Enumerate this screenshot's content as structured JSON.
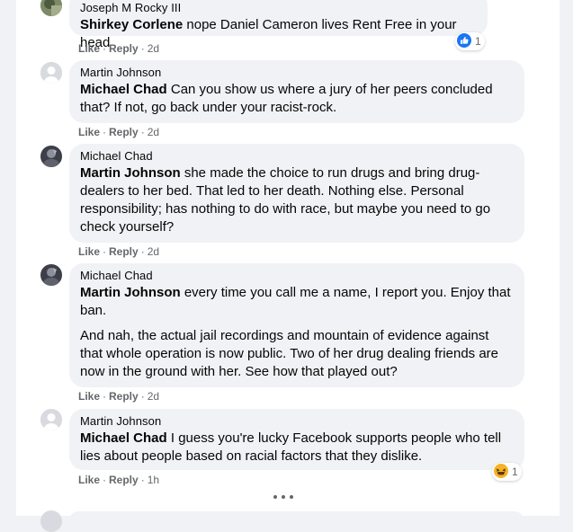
{
  "actions": {
    "like": "Like",
    "reply": "Reply",
    "separator": "·"
  },
  "comments": [
    {
      "author": "Joseph M Rocky III",
      "mention": "Shirkey Corlene",
      "text": "nope Daniel Cameron lives Rent Free in your head",
      "time": "2d",
      "reaction": {
        "icon": "thumbs-up-icon",
        "count": "1"
      }
    },
    {
      "author": "Martin Johnson",
      "mention": "Michael Chad",
      "text": "Can you show us where a jury of her peers concluded that? If not, go back under your racist-rock.",
      "time": "2d"
    },
    {
      "author": "Michael Chad",
      "mention": "Martin Johnson",
      "text": "she made the choice to run drugs and bring drug-dealers to her bed. That led to her death. Nothing else. Personal responsibility; has nothing to do with race, but maybe you need to go check yourself?",
      "time": "2d"
    },
    {
      "author": "Michael Chad",
      "mention": "Martin Johnson",
      "text": "every time you call me a name, I report you. Enjoy that ban.",
      "text2": "And nah, the actual jail recordings and mountain of evidence against that whole operation is now public. Two of her drug dealing friends are now in the ground with her. See how that played out?",
      "time": "2d"
    },
    {
      "author": "Martin Johnson",
      "mention": "Michael Chad",
      "text": "I guess you're lucky Facebook supports people who tell lies about people based on racial factors that they dislike.",
      "time": "1h",
      "reaction": {
        "icon": "laughing-face-icon",
        "count": "1"
      }
    }
  ],
  "colors": {
    "like_blue": "#1877f2",
    "haha_yellow": "#f7b125",
    "bubble": "#f0f2f5",
    "meta": "#65676b"
  }
}
